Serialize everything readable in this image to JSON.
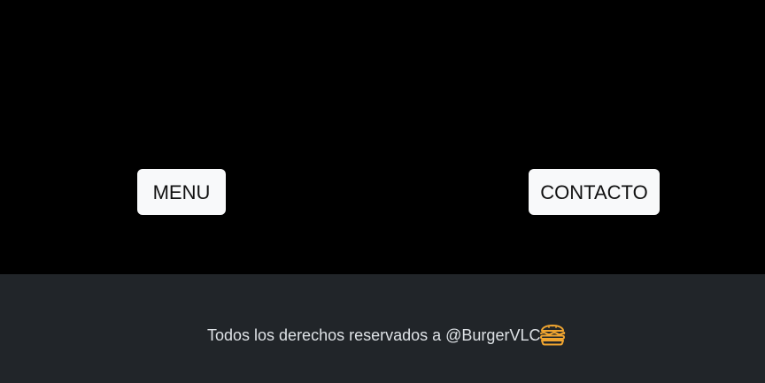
{
  "nav": {
    "menu_label": "MENU",
    "contact_label": "CONTACTO"
  },
  "footer": {
    "copyright_text": "Todos los derechos reservados a @BurgerVLC",
    "icon": "burger-icon"
  },
  "colors": {
    "background": "#000000",
    "button_bg": "#f8f9fa",
    "footer_bg": "#212529",
    "footer_text": "#dee2e6",
    "icon_accent": "#f0a530"
  }
}
